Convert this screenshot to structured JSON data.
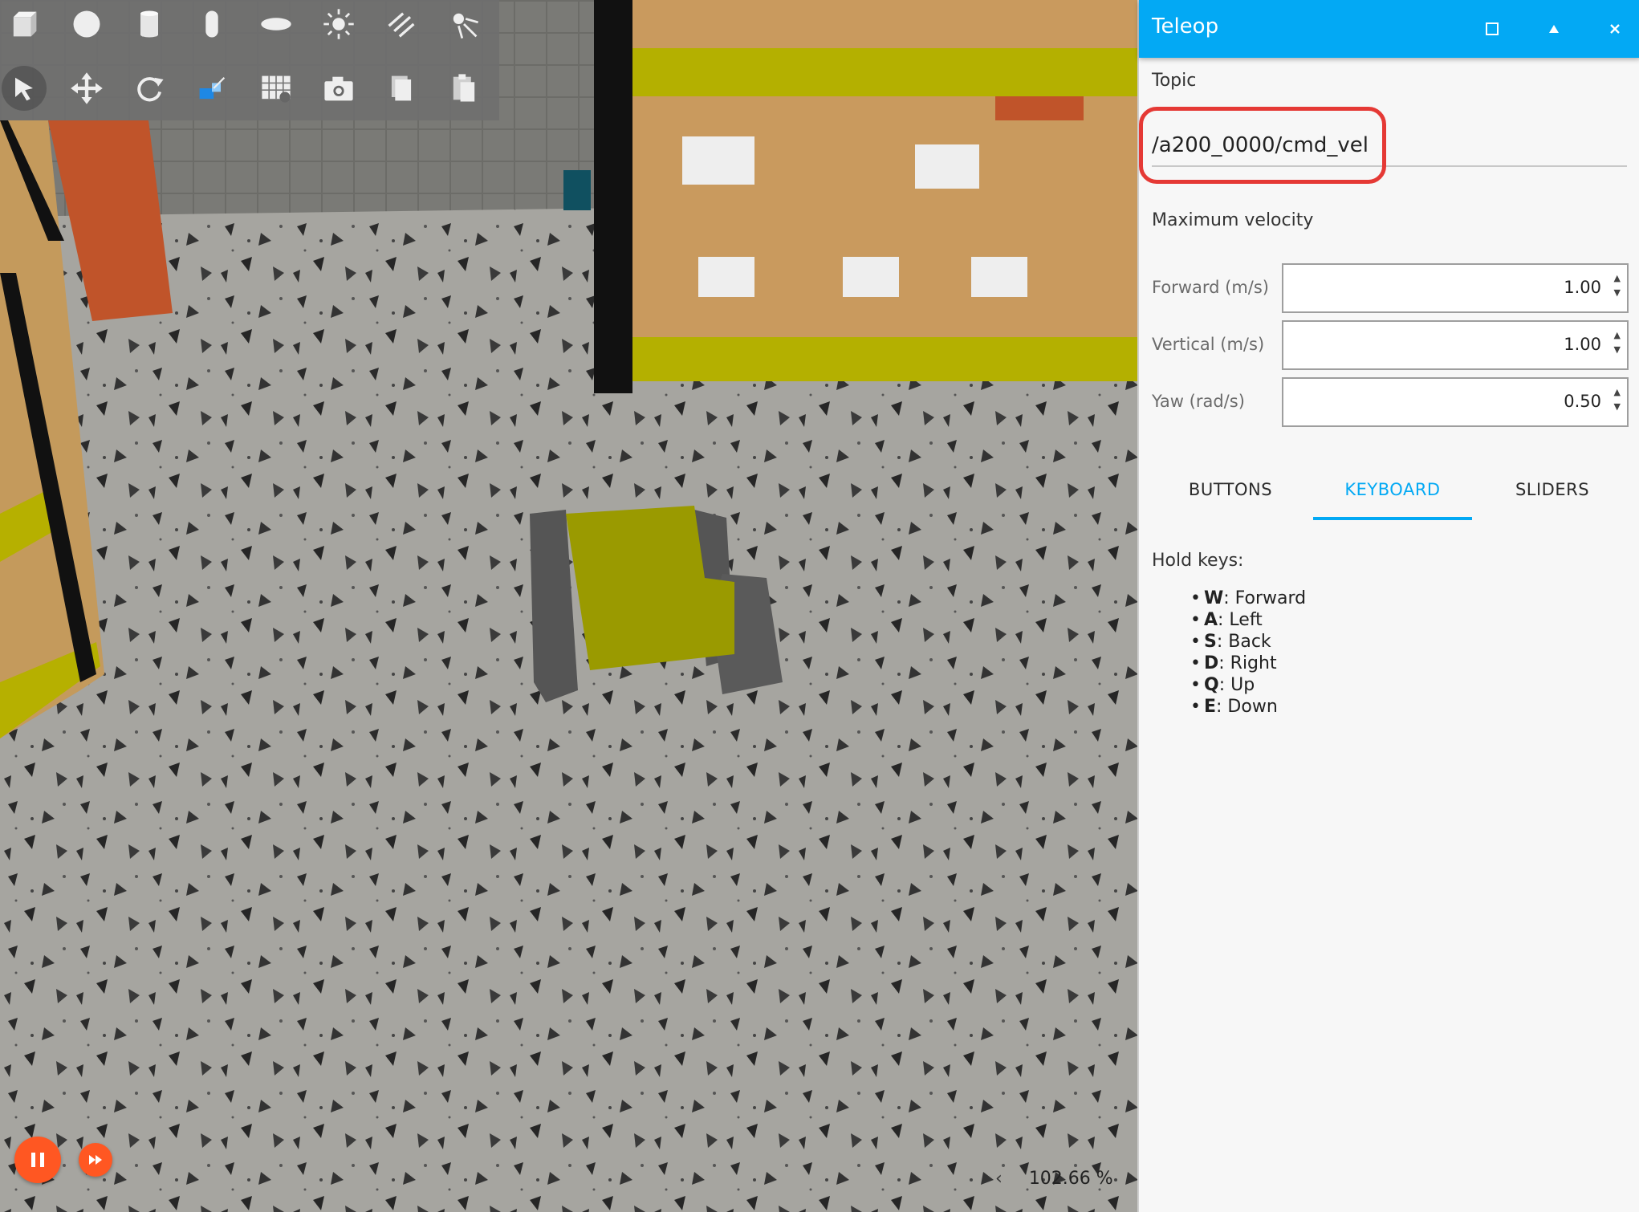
{
  "toolbar": {
    "row1": [
      "box-icon",
      "sphere-icon",
      "cylinder-icon",
      "capsule-icon",
      "ellipsoid-icon",
      "sun-icon",
      "directional-light-icon",
      "spot-light-icon"
    ],
    "row2": [
      "select-arrow-icon",
      "translate-icon",
      "rotate-icon",
      "scale-icon",
      "align-grid-icon",
      "camera-icon",
      "copy-icon",
      "paste-icon"
    ]
  },
  "playback": {
    "zoom": "102.66 %",
    "prev": "‹"
  },
  "panel": {
    "title": "Teleop",
    "topic_label": "Topic",
    "topic_value": "/a200_0000/cmd_vel",
    "max_velocity_label": "Maximum velocity",
    "forward_label": "Forward (m/s)",
    "forward_value": "1.00",
    "vertical_label": "Vertical (m/s)",
    "vertical_value": "1.00",
    "yaw_label": "Yaw (rad/s)",
    "yaw_value": "0.50",
    "tabs": [
      "BUTTONS",
      "KEYBOARD",
      "SLIDERS"
    ],
    "active_tab": "KEYBOARD",
    "hold_keys_label": "Hold keys:",
    "keys": [
      {
        "key": "W",
        "action": ": Forward"
      },
      {
        "key": "A",
        "action": ": Left"
      },
      {
        "key": "S",
        "action": ": Back"
      },
      {
        "key": "D",
        "action": ": Right"
      },
      {
        "key": "Q",
        "action": ": Up"
      },
      {
        "key": "E",
        "action": ": Down"
      }
    ]
  },
  "colors": {
    "accent": "#03a9f4",
    "highlight": "#e53935",
    "play": "#ff5722",
    "robot_body": "#9a9a00"
  }
}
